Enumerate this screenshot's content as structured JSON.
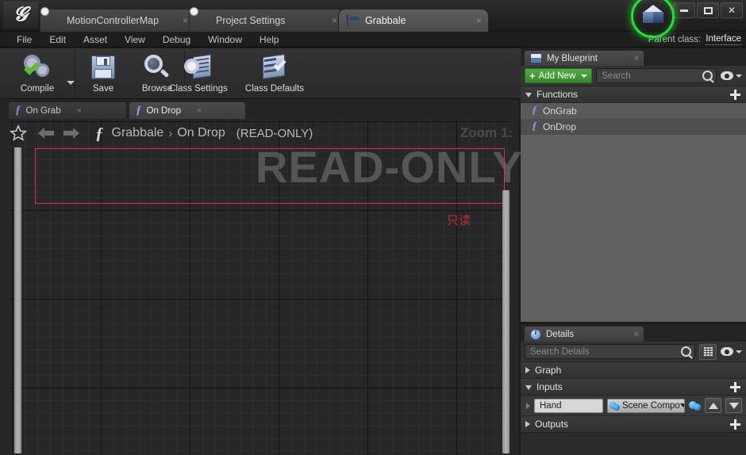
{
  "window": {
    "logo": "unreal-logo",
    "tabs": [
      {
        "label": "MotionControllerMap",
        "icon": "map-icon",
        "close": "×",
        "active": false
      },
      {
        "label": "Project Settings",
        "icon": "settings-gear-icon",
        "close": "×",
        "active": false
      },
      {
        "label": "Grabbale",
        "icon": "blueprint-icon",
        "close": "×",
        "active": true
      }
    ],
    "controls": {
      "minimize": "minimize-icon",
      "maximize": "maximize-icon",
      "close": "✕"
    }
  },
  "menubar": {
    "items": [
      "File",
      "Edit",
      "Asset",
      "View",
      "Debug",
      "Window",
      "Help"
    ]
  },
  "parent_class": {
    "label": "Parent class:",
    "value": "Interface"
  },
  "toolbar": {
    "buttons": [
      {
        "label": "Compile",
        "icon": "compile-icon",
        "has_dropdown": true
      },
      {
        "label": "Save",
        "icon": "save-icon",
        "has_dropdown": false
      },
      {
        "label": "Browse",
        "icon": "browse-icon",
        "has_dropdown": false
      },
      {
        "label": "Class Settings",
        "icon": "class-settings-icon",
        "has_dropdown": false
      },
      {
        "label": "Class Defaults",
        "icon": "class-defaults-icon",
        "has_dropdown": false
      }
    ]
  },
  "graph": {
    "tabs": [
      {
        "label": "On Grab",
        "icon": "function-icon",
        "close": "×",
        "active": false
      },
      {
        "label": "On Drop",
        "icon": "function-icon",
        "close": "×",
        "active": true
      }
    ],
    "breadcrumb": {
      "star": "favorite-star-icon",
      "back": "back-arrow-icon",
      "forward": "forward-arrow-icon",
      "fx": "ƒ",
      "root": "Grabbale",
      "separator": "›",
      "current": "On Drop",
      "state": "(READ-ONLY)"
    },
    "zoom_label": "Zoom 1:",
    "watermark": "READ-ONLY",
    "annotation_cn": "只读",
    "annotation_color": "#c8283c",
    "highlight_color": "#25e033"
  },
  "my_blueprint": {
    "tab": {
      "label": "My Blueprint",
      "icon": "blueprint-book-icon",
      "close": "×"
    },
    "add_new": {
      "label": "Add New",
      "plus": "+"
    },
    "search": {
      "placeholder": "Search",
      "icon": "search-icon"
    },
    "eye": "visibility-eye-icon",
    "sections": [
      {
        "label": "Functions",
        "expanded": true,
        "add": "add-icon",
        "items": [
          {
            "label": "OnGrab",
            "icon": "function-icon",
            "selected": true
          },
          {
            "label": "OnDrop",
            "icon": "function-icon",
            "selected": false
          }
        ]
      }
    ]
  },
  "details": {
    "tab": {
      "label": "Details",
      "icon": "details-info-icon",
      "close": "×"
    },
    "search": {
      "placeholder": "Search Details",
      "icon": "search-icon"
    },
    "grid_button": "grid-view-icon",
    "eye": "visibility-eye-icon",
    "sections": [
      {
        "label": "Graph",
        "expanded": false,
        "has_add": false
      },
      {
        "label": "Inputs",
        "expanded": true,
        "has_add": true
      },
      {
        "label": "Outputs",
        "expanded": false,
        "has_add": true
      }
    ],
    "inputs": [
      {
        "name": "Hand",
        "type": "Scene Compo",
        "type_icon": "object-pin-icon",
        "out_pin": "pin-icon",
        "move_up": "move-up-icon",
        "move_down": "move-down-icon"
      }
    ]
  }
}
